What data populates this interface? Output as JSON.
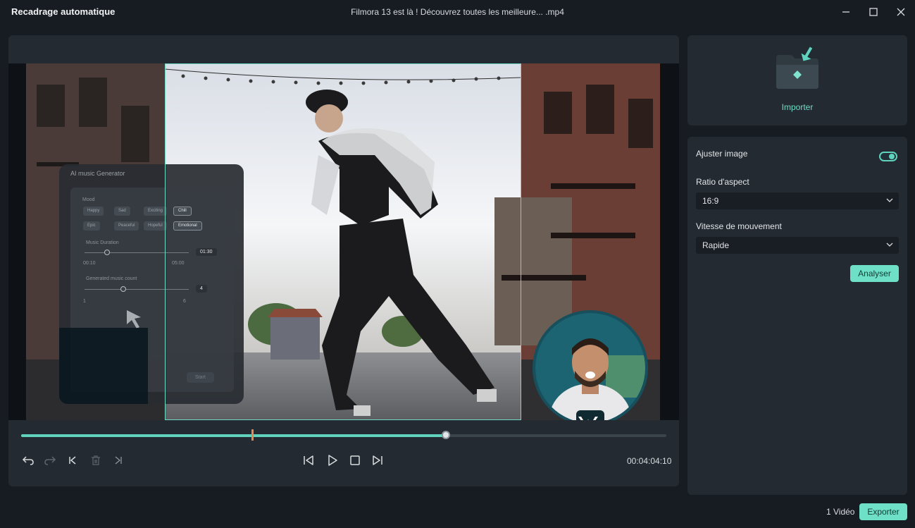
{
  "window": {
    "app_title": "Recadrage automatique",
    "file_title": "Filmora 13 est là ! Découvrez toutes les meilleure... .mp4"
  },
  "embedded_card": {
    "title": "AI music Generator",
    "mood_label": "Mood",
    "moods_row1": [
      "Happy",
      "Sad",
      "Exciting",
      "Chill"
    ],
    "moods_row2": [
      "Epic",
      "Peaceful",
      "Hopeful",
      "Emotional"
    ],
    "duration_label": "Music Duration",
    "duration_value": "01:30",
    "duration_min": "00:10",
    "duration_max": "05:00",
    "count_label": "Generated music count",
    "count_value": "4",
    "count_min": "1",
    "count_max": "6",
    "start_label": "Start"
  },
  "player": {
    "timecode": "00:04:04:10",
    "progress_fraction": 0.658,
    "marker_fraction": 0.358
  },
  "import": {
    "label": "Importer"
  },
  "settings": {
    "adjust_label": "Ajuster image",
    "adjust_on": true,
    "ratio_label": "Ratio d'aspect",
    "ratio_value": "16:9",
    "speed_label": "Vitesse de mouvement",
    "speed_value": "Rapide",
    "analyze_label": "Analyser"
  },
  "footer": {
    "count_label": "1 Vidéo",
    "export_label": "Exporter"
  },
  "colors": {
    "accent": "#5fd3bd",
    "button": "#6fe0c8",
    "marker": "#e8874a",
    "panel": "#232a31",
    "background": "#171c22"
  },
  "icons": [
    "undo-icon",
    "redo-icon",
    "jump-start-icon",
    "delete-icon",
    "jump-end-icon",
    "prev-frame-icon",
    "play-icon",
    "stop-icon",
    "next-frame-icon",
    "folder-import-icon",
    "chevron-down-icon",
    "minimize-icon",
    "maximize-icon",
    "close-icon",
    "cursor-icon",
    "wondershare-logo-icon"
  ]
}
